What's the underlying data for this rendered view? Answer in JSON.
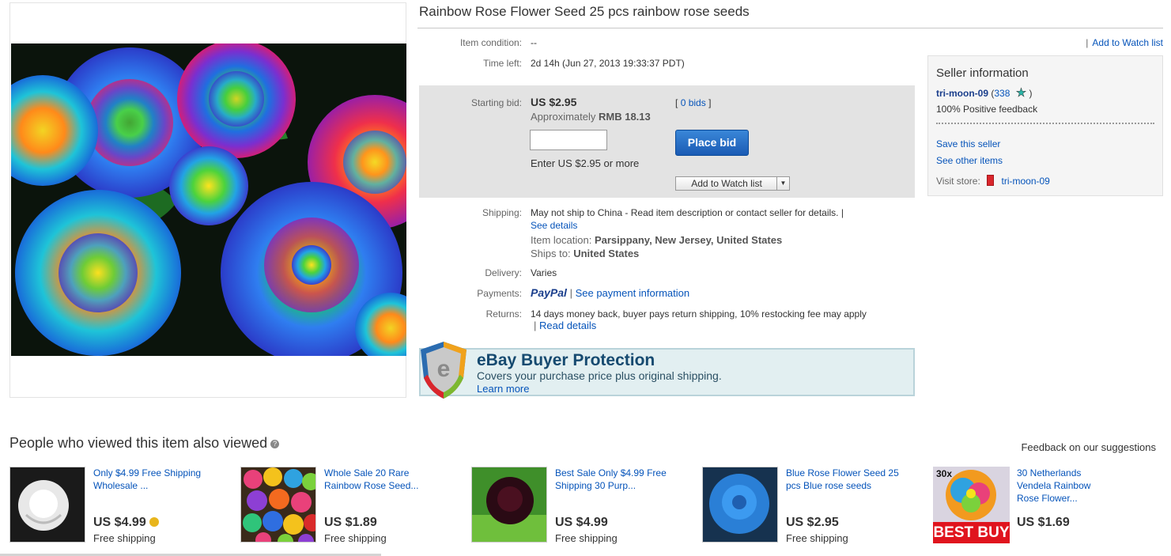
{
  "listing": {
    "title": "Rainbow Rose Flower Seed 25 pcs rainbow rose seeds",
    "condition_label": "Item condition:",
    "condition_value": "--",
    "time_left_label": "Time left:",
    "time_left_value": "2d 14h (Jun 27, 2013  19:33:37 PDT)",
    "watch_top": "Add to Watch list"
  },
  "bid": {
    "label": "Starting bid:",
    "price": "US $2.95",
    "approx_prefix": "Approximately",
    "approx_value": "RMB 18.13",
    "bids_open": "[",
    "bids_link": "0 bids",
    "bids_close": "]",
    "enter_hint": "Enter US $2.95 or more",
    "place_bid": "Place bid",
    "watch_button": "Add to Watch list"
  },
  "shipping": {
    "label": "Shipping:",
    "text": "May not ship to China - Read item description or contact seller for details. |",
    "see_details": "See details",
    "location_label": "Item location:",
    "location_value": "Parsippany, New Jersey, United States",
    "ships_to_label": "Ships to:",
    "ships_to_value": "United States"
  },
  "delivery": {
    "label": "Delivery:",
    "value": "Varies"
  },
  "payments": {
    "label": "Payments:",
    "paypal": "PayPal",
    "sep": "|",
    "link": "See payment information"
  },
  "returns": {
    "label": "Returns:",
    "text": "14 days money back, buyer pays return shipping, 10% restocking fee may apply",
    "sep": "|",
    "link": "Read details"
  },
  "seller": {
    "heading": "Seller information",
    "name": "tri-moon-09",
    "score": "338",
    "feedback": "100% Positive feedback",
    "save": "Save this seller",
    "other": "See other items",
    "visit_label": "Visit store:",
    "store": "tri-moon-09",
    "star_color": "#2ab7a9"
  },
  "protection": {
    "title": "eBay Buyer Protection",
    "subtitle": "Covers your purchase price plus original shipping.",
    "learn_more": "Learn more"
  },
  "also_viewed": {
    "title": "People who viewed this item also viewed",
    "help": "?",
    "feedback": "Feedback on our suggestions",
    "items": [
      {
        "title": "Only $4.99 Free Shipping Wholesale ...",
        "price": "US $4.99",
        "shipping": "Free shipping"
      },
      {
        "title": "Whole Sale 20 Rare Rainbow Rose Seed...",
        "price": "US $1.89",
        "shipping": "Free shipping"
      },
      {
        "title": "Best Sale Only $4.99 Free Shipping 30 Purp...",
        "price": "US $4.99",
        "shipping": "Free shipping"
      },
      {
        "title": "Blue Rose Flower Seed 25 pcs Blue rose seeds",
        "price": "US $2.95",
        "shipping": "Free shipping"
      },
      {
        "title": "30 Netherlands Vendela Rainbow Rose Flower...",
        "price": "US $1.69",
        "badge_count": "30x",
        "badge": "BEST BUY"
      }
    ]
  },
  "colors": {
    "link": "#0654ba",
    "button": "#1b5bb4",
    "bidbox": "#e3e3e3"
  }
}
